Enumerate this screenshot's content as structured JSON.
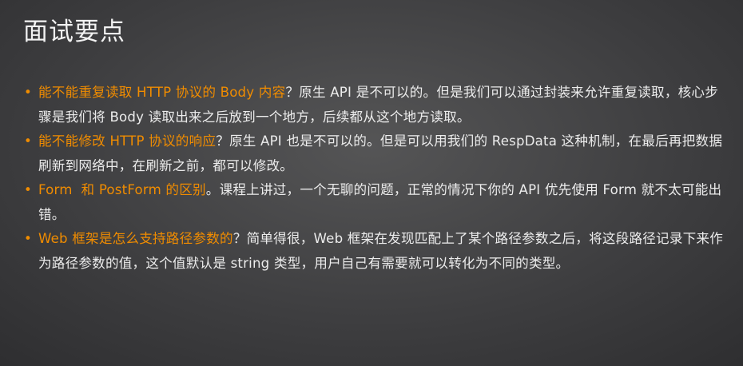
{
  "title": "面试要点",
  "colors": {
    "accent": "#f08c00"
  },
  "items": [
    {
      "highlight": "能不能重复读取 HTTP 协议的 Body 内容",
      "text": "？原生 API 是不可以的。但是我们可以通过封装来允许重复读取，核心步骤是我们将 Body 读取出来之后放到一个地方，后续都从这个地方读取。"
    },
    {
      "highlight": "能不能修改 HTTP 协议的响应",
      "text": "？原生 API 也是不可以的。但是可以用我们的 RespData 这种机制，在最后再把数据刷新到网络中，在刷新之前，都可以修改。"
    },
    {
      "highlight": "Form  和 PostForm 的区别",
      "text": "。课程上讲过，一个无聊的问题，正常的情况下你的 API 优先使用 Form 就不太可能出错。"
    },
    {
      "highlight": "Web 框架是怎么支持路径参数的",
      "text": "？简单得很，Web 框架在发现匹配上了某个路径参数之后，将这段路径记录下来作为路径参数的值，这个值默认是 string 类型，用户自己有需要就可以转化为不同的类型。"
    }
  ]
}
